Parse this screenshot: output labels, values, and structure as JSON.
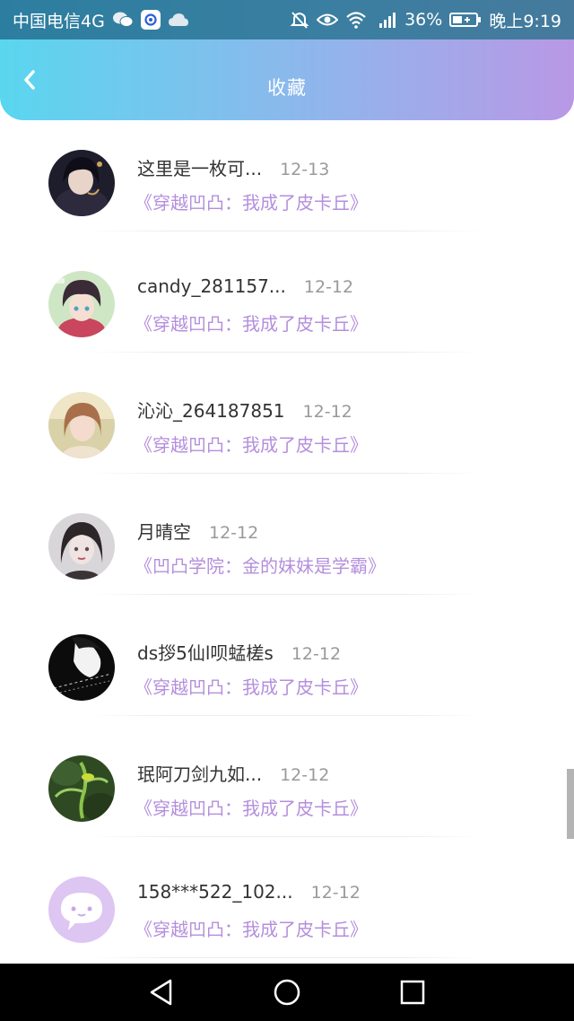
{
  "status_bar": {
    "carrier": "中国电信4G",
    "battery": "36%",
    "time": "晚上9:19",
    "icons": [
      "wechat-icon",
      "app-icon",
      "cloud-icon",
      "mute-icon",
      "eye-icon",
      "wifi-icon",
      "signal-icon",
      "battery-icon"
    ]
  },
  "header": {
    "title": "收藏",
    "back_icon": "back-chevron-icon"
  },
  "list": [
    {
      "username": "这里是一枚可...",
      "date": "12-13",
      "book": "《穿越凹凸：我成了皮卡丘》"
    },
    {
      "username": "candy_281157...",
      "date": "12-12",
      "book": "《穿越凹凸：我成了皮卡丘》"
    },
    {
      "username": "沁沁_264187851",
      "date": "12-12",
      "book": "《穿越凹凸：我成了皮卡丘》"
    },
    {
      "username": "月晴空",
      "date": "12-12",
      "book": "《凹凸学院：金的妹妹是学霸》"
    },
    {
      "username": "ds拶5仙l呗蜢槎s",
      "date": "12-12",
      "book": "《穿越凹凸：我成了皮卡丘》"
    },
    {
      "username": "珉阿刀剑九如...",
      "date": "12-12",
      "book": "《穿越凹凸：我成了皮卡丘》"
    },
    {
      "username": "158***522_102...",
      "date": "12-12",
      "book": "《穿越凹凸：我成了皮卡丘》"
    }
  ],
  "nav_bar": {
    "icons": [
      "back-triangle-icon",
      "home-circle-icon",
      "recents-square-icon"
    ]
  },
  "colors": {
    "header_start": "#5ad6ef",
    "header_end": "#b998e6",
    "book_title": "#b48fdc",
    "username": "#333333",
    "date": "#9a9a9a"
  }
}
